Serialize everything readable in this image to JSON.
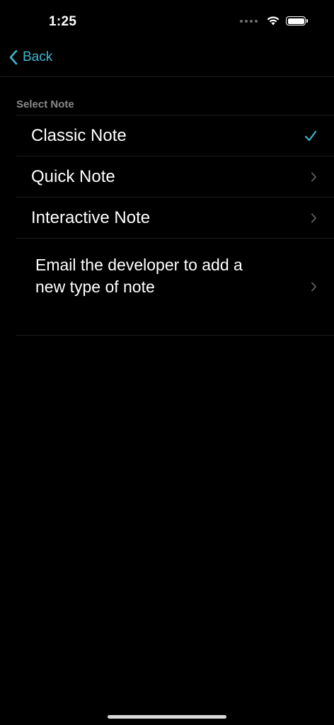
{
  "status_bar": {
    "time": "1:25"
  },
  "nav": {
    "back_label": "Back"
  },
  "section": {
    "header": "Select Note"
  },
  "options": [
    {
      "label": "Classic Note",
      "accessory": "checkmark-icon",
      "selected": true
    },
    {
      "label": "Quick Note",
      "accessory": "chevron-right-icon",
      "selected": false
    },
    {
      "label": "Interactive Note",
      "accessory": "chevron-right-icon",
      "selected": false
    },
    {
      "label": "Email the developer to add a new type of note",
      "accessory": "chevron-right-icon",
      "selected": false
    }
  ],
  "colors": {
    "accent": "#3fb6cf",
    "background": "#000000",
    "separator": "#1c1c1e",
    "secondary_text": "#8a8a8e",
    "chevron": "#5a5a5e"
  }
}
